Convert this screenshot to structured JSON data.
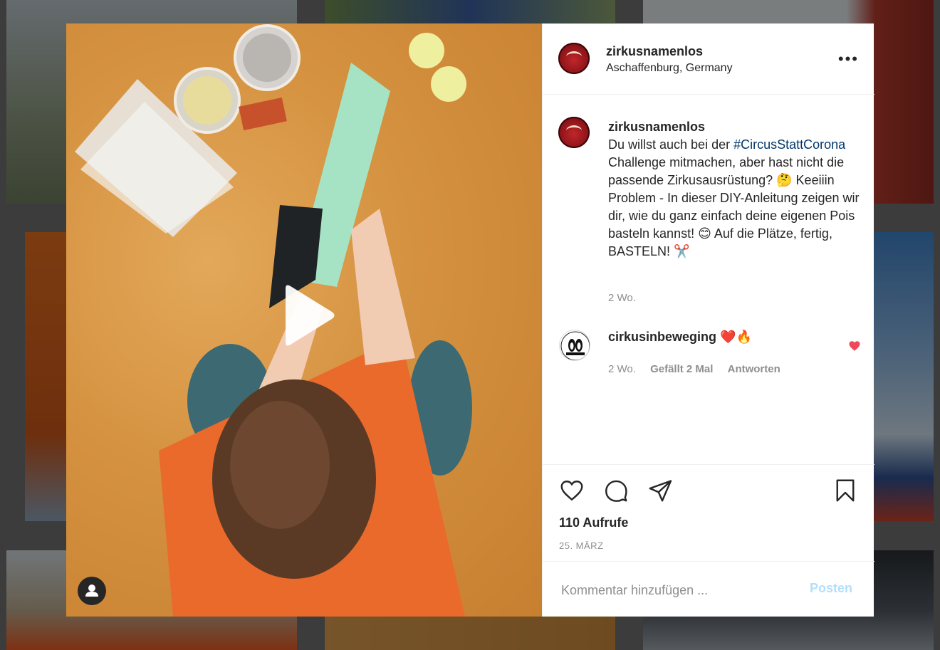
{
  "post": {
    "username": "zirkusnamenlos",
    "location": "Aschaffenburg, Germany",
    "caption": {
      "username": "zirkusnamenlos",
      "text_before": "Du willst auch bei der ",
      "hashtag": "#CircusStattCorona",
      "text_after": " Challenge mitmachen, aber hast nicht die passende Zirkusausrüstung? 🤔 Keeiiin Problem - In dieser DIY-Anleitung zeigen wir dir, wie du ganz einfach deine eigenen Pois basteln kannst! 😊 Auf die Plätze, fertig, BASTELN! ✂️",
      "time": "2 Wo."
    },
    "comments": [
      {
        "username": "cirkusinbeweging",
        "text": "❤️🔥",
        "time": "2 Wo.",
        "likes": "Gefällt 2 Mal",
        "reply": "Antworten"
      }
    ],
    "views": "110 Aufrufe",
    "date": "25. MÄRZ",
    "comment_placeholder": "Kommentar hinzufügen ...",
    "post_button": "Posten"
  },
  "colors": {
    "link": "#00376b",
    "like_red": "#ed4956",
    "post_button_disabled": "#b2dffc",
    "secondary_text": "#8e8e8e"
  },
  "icons": {
    "like": "heart-outline-icon",
    "comment": "speech-bubble-icon",
    "share": "paper-plane-icon",
    "save": "bookmark-icon",
    "more": "ellipsis-icon",
    "play": "play-icon",
    "tag": "user-tag-icon"
  }
}
